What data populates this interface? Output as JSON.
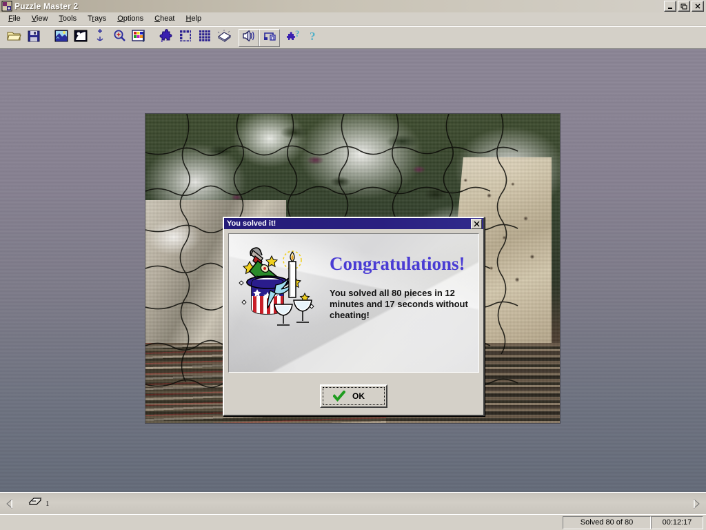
{
  "window": {
    "title": "Puzzle Master 2",
    "icon": "puzzle-app-icon",
    "minimize_label": "Minimize",
    "restore_label": "Restore",
    "close_label": "Close"
  },
  "menubar": {
    "items": [
      {
        "label": "File",
        "accel": "F"
      },
      {
        "label": "View",
        "accel": "V"
      },
      {
        "label": "Tools",
        "accel": "T"
      },
      {
        "label": "Trays",
        "accel": "r"
      },
      {
        "label": "Options",
        "accel": "O"
      },
      {
        "label": "Cheat",
        "accel": "C"
      },
      {
        "label": "Help",
        "accel": "H"
      }
    ]
  },
  "toolbar": {
    "buttons": [
      {
        "name": "open-puzzle-button",
        "icon": "folder-open-icon"
      },
      {
        "name": "save-puzzle-button",
        "icon": "floppy-disk-icon"
      },
      {
        "name": "new-picture-button",
        "icon": "picture-icon"
      },
      {
        "name": "preview-picture-button",
        "icon": "photo-dark-icon"
      },
      {
        "name": "move-button",
        "icon": "move-crosshair-icon"
      },
      {
        "name": "zoom-button",
        "icon": "magnifier-plus-icon"
      },
      {
        "name": "palette-button",
        "icon": "color-palette-icon"
      },
      {
        "name": "piece-shape-button",
        "icon": "puzzle-piece-icon"
      },
      {
        "name": "edge-pieces-button",
        "icon": "edge-frame-icon"
      },
      {
        "name": "all-pieces-button",
        "icon": "grid-pieces-icon"
      },
      {
        "name": "table-button",
        "icon": "table-surface-icon"
      },
      {
        "name": "sound-toggle-button",
        "icon": "speaker-icon"
      },
      {
        "name": "music-toggle-button",
        "icon": "music-notes-icon"
      },
      {
        "name": "help-puzzle-button",
        "icon": "puzzle-help-icon"
      },
      {
        "name": "about-button",
        "icon": "question-mark-icon"
      }
    ]
  },
  "dialog": {
    "title": "You solved it!",
    "close_label": "×",
    "heading": "Congratulations!",
    "message": "You solved all 80 pieces in 12 minutes and 17 seconds without cheating!",
    "ok_label": "OK",
    "illustration": "celebration-champagne-icon"
  },
  "traybar": {
    "scroll_left": "scroll-left-arrow",
    "scroll_right": "scroll-right-arrow",
    "tray_icon": "tray-icon",
    "tray_count": "1"
  },
  "statusbar": {
    "solved": "Solved 80 of 80",
    "time": "00:12:17"
  },
  "puzzle": {
    "pieces_total": 80,
    "pieces_solved": 80,
    "elapsed": "00:12:17"
  },
  "colors": {
    "desktop_top": "#8a8494",
    "desktop_bottom": "#636a78",
    "dialog_titlebar": "#2a2080",
    "congrats_text": "#4a3cd4",
    "face": "#d4d0c8",
    "check_green": "#1f9c1f"
  }
}
